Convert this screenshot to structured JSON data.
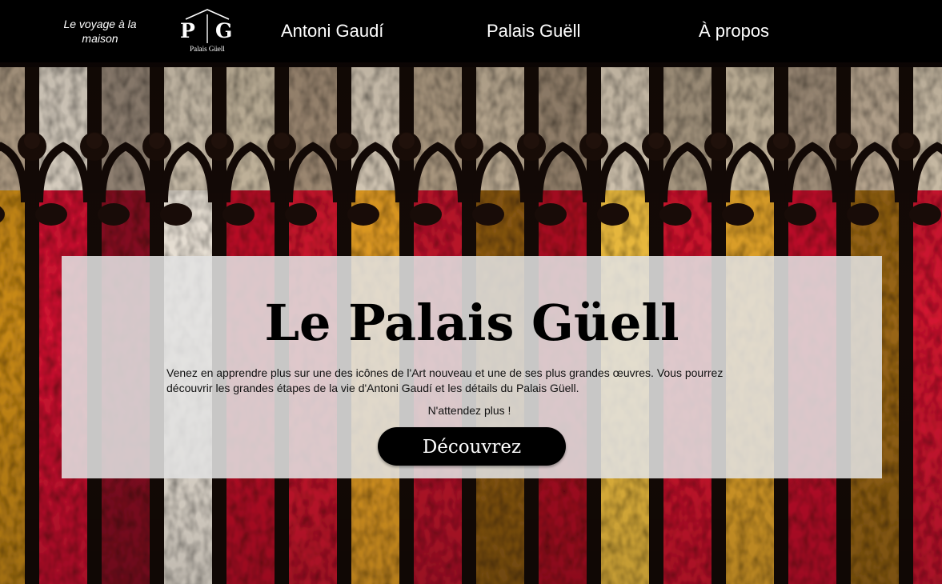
{
  "header": {
    "tagline": "Le voyage à la maison",
    "logo": {
      "letter_left": "P",
      "letter_right": "G",
      "caption": "Palais Güell"
    },
    "nav": [
      {
        "label": "Antoni Gaudí"
      },
      {
        "label": "Palais Guëll"
      },
      {
        "label": "À propos"
      }
    ]
  },
  "hero": {
    "title": "Le Palais Güell",
    "description": "Venez en apprendre plus sur une des icônes de l'Art nouveau et une de ses plus grandes œuvres. Vous pourrez découvrir les grandes étapes de la vie d'Antoni Gaudí et les détails du Palais Güell.",
    "cta_text": "N'attendez plus !",
    "cta_button": "Découvrez"
  },
  "colors": {
    "header_bg": "#000000",
    "card_bg": "#e1e1e1",
    "button_bg": "#000000",
    "glass_red": "#c8102e",
    "glass_amber": "#d99a1c",
    "glass_white": "#f1e8dc"
  }
}
